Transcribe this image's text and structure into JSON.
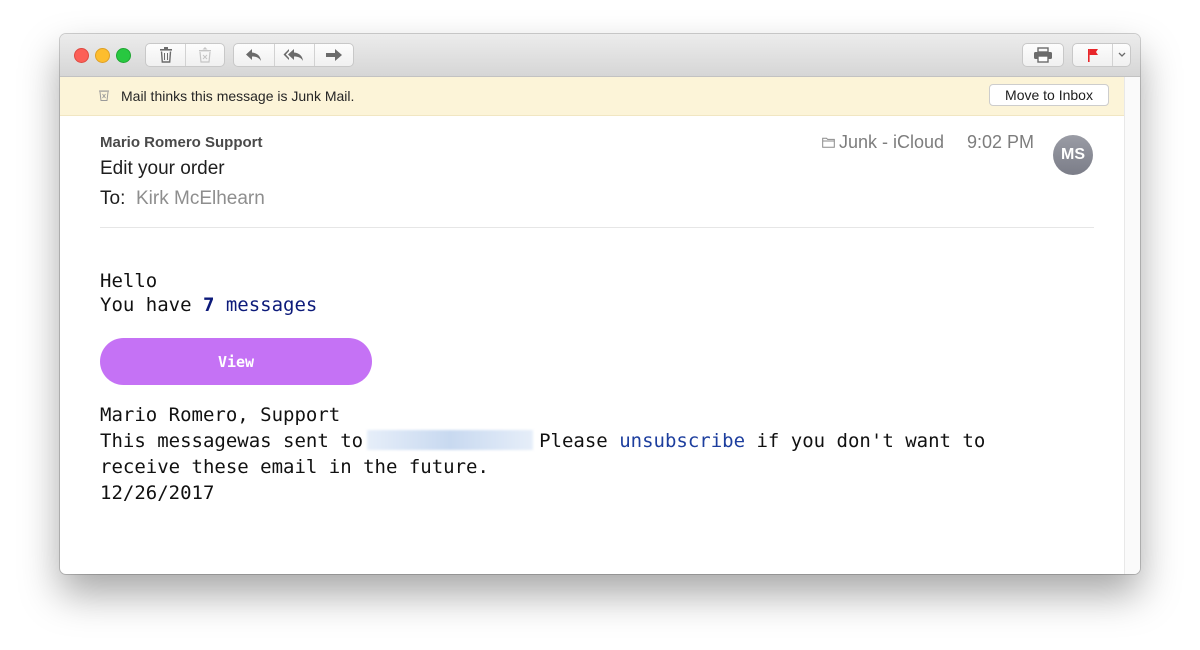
{
  "toolbar": {
    "traffic_lights": [
      "close",
      "minimize",
      "zoom"
    ],
    "buttons": [
      {
        "name": "delete",
        "icon": "trash-icon"
      },
      {
        "name": "junk",
        "icon": "junk-icon"
      },
      {
        "name": "reply",
        "icon": "reply-icon"
      },
      {
        "name": "reply-all",
        "icon": "reply-all-icon"
      },
      {
        "name": "forward",
        "icon": "forward-icon"
      },
      {
        "name": "print",
        "icon": "printer-icon"
      },
      {
        "name": "flag",
        "icon": "flag-icon"
      },
      {
        "name": "flag-menu",
        "icon": "chevron-down-icon"
      }
    ],
    "flag_color": "#e8262a"
  },
  "banner": {
    "text": "Mail thinks this message is Junk Mail.",
    "button_label": "Move to Inbox",
    "background": "#fcf4d8"
  },
  "message": {
    "from": "Mario Romero Support",
    "subject": "Edit your order",
    "to_label": "To:",
    "to": "Kirk McElhearn",
    "mailbox": "Junk - iCloud",
    "time": "9:02 PM",
    "avatar_initials": "MS"
  },
  "body": {
    "greeting": "Hello",
    "count_prefix": "You have ",
    "count": "7",
    "count_suffix": " messages",
    "button_label": "View",
    "button_color": "#c572f5",
    "signature": "Mario Romero, Support",
    "sent_prefix": "This messagewas sent to",
    "please": "Please",
    "unsubscribe": "unsubscribe",
    "sent_suffix": " if you don't want to",
    "line2": "receive these email in the future.",
    "date": "12/26/2017"
  }
}
